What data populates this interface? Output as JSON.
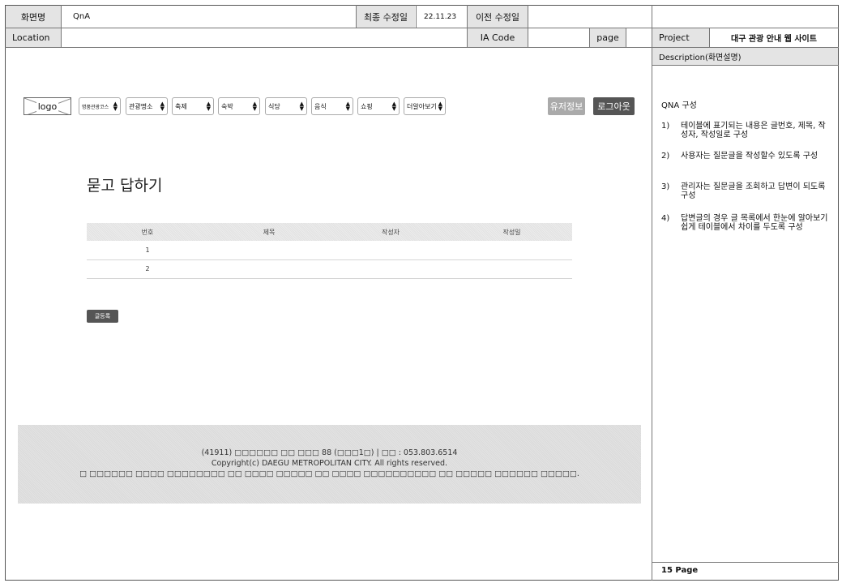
{
  "header": {
    "screen_name_label": "화면명",
    "screen_name": "QnA",
    "last_modified_label": "최종 수정일",
    "last_modified": "22.11.23",
    "prev_modified_label": "이전 수정일",
    "prev_modified": "",
    "location_label": "Location",
    "location": "",
    "ia_code_label": "IA Code",
    "ia_code": "",
    "page_label": "page",
    "page": "",
    "project_label": "Project",
    "project": "대구 관광 안내 웹 사이트"
  },
  "nav": {
    "logo": "logo",
    "selects": [
      "명품관광코스",
      "관광명소",
      "축제",
      "숙박",
      "식당",
      "음식",
      "쇼핑",
      "더알아보기"
    ],
    "user_info": "유저정보",
    "logout": "로그아웃"
  },
  "main": {
    "title": "묻고 답하기",
    "columns": [
      "번호",
      "제목",
      "작성자",
      "작성일"
    ],
    "rows": [
      [
        "1",
        "",
        "",
        ""
      ],
      [
        "2",
        "",
        "",
        ""
      ]
    ],
    "write_button": "글등록"
  },
  "footer": {
    "line1": "(41911) □□□□□□ □□ □□□ 88 (□□□1□) | □□ : 053.803.6514",
    "line2": "Copyright(c) DAEGU METROPOLITAN CITY. All rights reserved.",
    "line3": "□ □□□□□□ □□□□ □□□□□□□□ □□ □□□□ □□□□□ □□ □□□□ □□□□□□□□□□ □□ □□□□□ □□□□□□ □□□□□."
  },
  "description": {
    "header": "Description(화면설명)",
    "title": "QNA 구성",
    "items": [
      {
        "num": "1)",
        "text": "테이블에 표기되는 내용은 글번호, 제목, 작성자, 작성일로 구성"
      },
      {
        "num": "2)",
        "text": "사용자는 질문글을 작성할수 있도록 구성"
      },
      {
        "num": "3)",
        "text": "관리자는 질문글을 조회하고 답변이 되도록 구성"
      },
      {
        "num": "4)",
        "text": "답변글의 경우 글 목록에서 한눈에 알아보기 쉽게 테이블에서 차이를 두도록 구성"
      }
    ],
    "page_footer": "15 Page"
  },
  "colors": {
    "header_gray": "#e4e4e4",
    "button_dark": "#555555",
    "button_light": "#aaaaaa"
  }
}
